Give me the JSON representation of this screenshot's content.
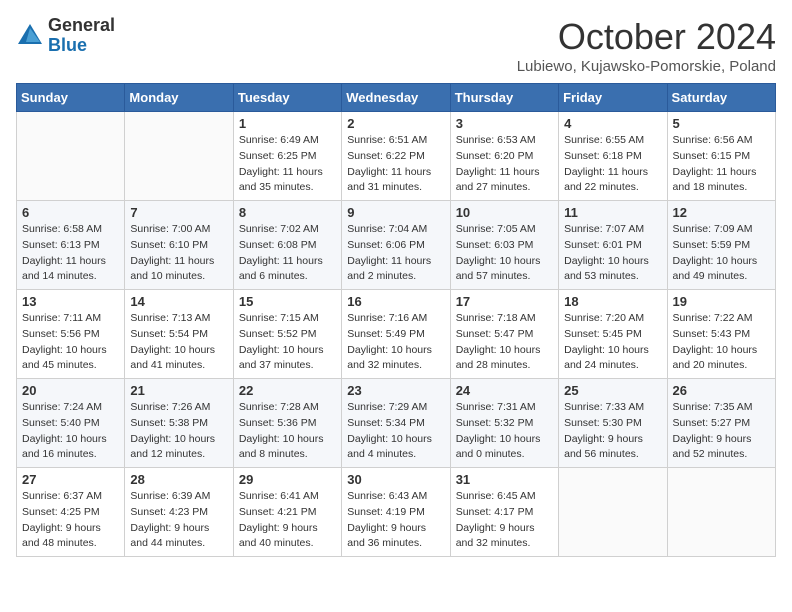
{
  "logo": {
    "general": "General",
    "blue": "Blue"
  },
  "title": "October 2024",
  "location": "Lubiewo, Kujawsko-Pomorskie, Poland",
  "weekdays": [
    "Sunday",
    "Monday",
    "Tuesday",
    "Wednesday",
    "Thursday",
    "Friday",
    "Saturday"
  ],
  "weeks": [
    [
      {
        "day": "",
        "info": ""
      },
      {
        "day": "",
        "info": ""
      },
      {
        "day": "1",
        "info": "Sunrise: 6:49 AM\nSunset: 6:25 PM\nDaylight: 11 hours and 35 minutes."
      },
      {
        "day": "2",
        "info": "Sunrise: 6:51 AM\nSunset: 6:22 PM\nDaylight: 11 hours and 31 minutes."
      },
      {
        "day": "3",
        "info": "Sunrise: 6:53 AM\nSunset: 6:20 PM\nDaylight: 11 hours and 27 minutes."
      },
      {
        "day": "4",
        "info": "Sunrise: 6:55 AM\nSunset: 6:18 PM\nDaylight: 11 hours and 22 minutes."
      },
      {
        "day": "5",
        "info": "Sunrise: 6:56 AM\nSunset: 6:15 PM\nDaylight: 11 hours and 18 minutes."
      }
    ],
    [
      {
        "day": "6",
        "info": "Sunrise: 6:58 AM\nSunset: 6:13 PM\nDaylight: 11 hours and 14 minutes."
      },
      {
        "day": "7",
        "info": "Sunrise: 7:00 AM\nSunset: 6:10 PM\nDaylight: 11 hours and 10 minutes."
      },
      {
        "day": "8",
        "info": "Sunrise: 7:02 AM\nSunset: 6:08 PM\nDaylight: 11 hours and 6 minutes."
      },
      {
        "day": "9",
        "info": "Sunrise: 7:04 AM\nSunset: 6:06 PM\nDaylight: 11 hours and 2 minutes."
      },
      {
        "day": "10",
        "info": "Sunrise: 7:05 AM\nSunset: 6:03 PM\nDaylight: 10 hours and 57 minutes."
      },
      {
        "day": "11",
        "info": "Sunrise: 7:07 AM\nSunset: 6:01 PM\nDaylight: 10 hours and 53 minutes."
      },
      {
        "day": "12",
        "info": "Sunrise: 7:09 AM\nSunset: 5:59 PM\nDaylight: 10 hours and 49 minutes."
      }
    ],
    [
      {
        "day": "13",
        "info": "Sunrise: 7:11 AM\nSunset: 5:56 PM\nDaylight: 10 hours and 45 minutes."
      },
      {
        "day": "14",
        "info": "Sunrise: 7:13 AM\nSunset: 5:54 PM\nDaylight: 10 hours and 41 minutes."
      },
      {
        "day": "15",
        "info": "Sunrise: 7:15 AM\nSunset: 5:52 PM\nDaylight: 10 hours and 37 minutes."
      },
      {
        "day": "16",
        "info": "Sunrise: 7:16 AM\nSunset: 5:49 PM\nDaylight: 10 hours and 32 minutes."
      },
      {
        "day": "17",
        "info": "Sunrise: 7:18 AM\nSunset: 5:47 PM\nDaylight: 10 hours and 28 minutes."
      },
      {
        "day": "18",
        "info": "Sunrise: 7:20 AM\nSunset: 5:45 PM\nDaylight: 10 hours and 24 minutes."
      },
      {
        "day": "19",
        "info": "Sunrise: 7:22 AM\nSunset: 5:43 PM\nDaylight: 10 hours and 20 minutes."
      }
    ],
    [
      {
        "day": "20",
        "info": "Sunrise: 7:24 AM\nSunset: 5:40 PM\nDaylight: 10 hours and 16 minutes."
      },
      {
        "day": "21",
        "info": "Sunrise: 7:26 AM\nSunset: 5:38 PM\nDaylight: 10 hours and 12 minutes."
      },
      {
        "day": "22",
        "info": "Sunrise: 7:28 AM\nSunset: 5:36 PM\nDaylight: 10 hours and 8 minutes."
      },
      {
        "day": "23",
        "info": "Sunrise: 7:29 AM\nSunset: 5:34 PM\nDaylight: 10 hours and 4 minutes."
      },
      {
        "day": "24",
        "info": "Sunrise: 7:31 AM\nSunset: 5:32 PM\nDaylight: 10 hours and 0 minutes."
      },
      {
        "day": "25",
        "info": "Sunrise: 7:33 AM\nSunset: 5:30 PM\nDaylight: 9 hours and 56 minutes."
      },
      {
        "day": "26",
        "info": "Sunrise: 7:35 AM\nSunset: 5:27 PM\nDaylight: 9 hours and 52 minutes."
      }
    ],
    [
      {
        "day": "27",
        "info": "Sunrise: 6:37 AM\nSunset: 4:25 PM\nDaylight: 9 hours and 48 minutes."
      },
      {
        "day": "28",
        "info": "Sunrise: 6:39 AM\nSunset: 4:23 PM\nDaylight: 9 hours and 44 minutes."
      },
      {
        "day": "29",
        "info": "Sunrise: 6:41 AM\nSunset: 4:21 PM\nDaylight: 9 hours and 40 minutes."
      },
      {
        "day": "30",
        "info": "Sunrise: 6:43 AM\nSunset: 4:19 PM\nDaylight: 9 hours and 36 minutes."
      },
      {
        "day": "31",
        "info": "Sunrise: 6:45 AM\nSunset: 4:17 PM\nDaylight: 9 hours and 32 minutes."
      },
      {
        "day": "",
        "info": ""
      },
      {
        "day": "",
        "info": ""
      }
    ]
  ]
}
